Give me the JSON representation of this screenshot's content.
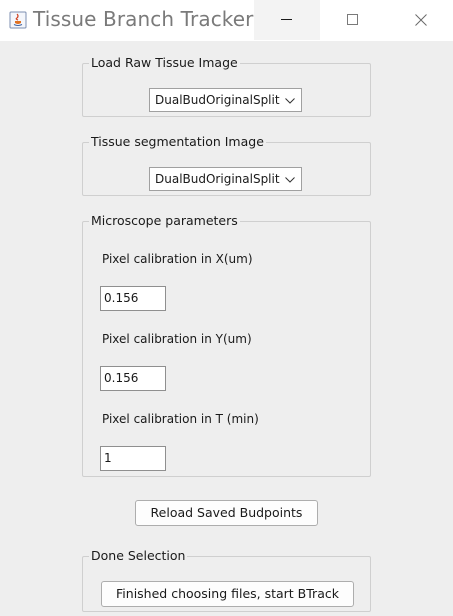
{
  "window": {
    "title": "Tissue Branch Tracker",
    "controls": [
      "minimize-icon",
      "maximize-icon",
      "close-icon"
    ]
  },
  "raw_image": {
    "legend": "Load Raw Tissue Image",
    "selected": "DualBudOriginalSplit"
  },
  "seg_image": {
    "legend": "Tissue segmentation Image",
    "selected": "DualBudOriginalSplit"
  },
  "microscope": {
    "legend": "Microscope parameters",
    "x_label": "Pixel calibration in X(um)",
    "x_value": "0.156",
    "y_label": "Pixel calibration in Y(um)",
    "y_value": "0.156",
    "t_label": "Pixel calibration in T (min)",
    "t_value": "1"
  },
  "reload_button": "Reload Saved Budpoints",
  "done": {
    "legend": "Done Selection",
    "button": "Finished choosing files, start BTrack"
  },
  "colors": {
    "background": "#eeeeee",
    "titlebar": "#ffffff",
    "title_text": "#7a7a7a"
  }
}
